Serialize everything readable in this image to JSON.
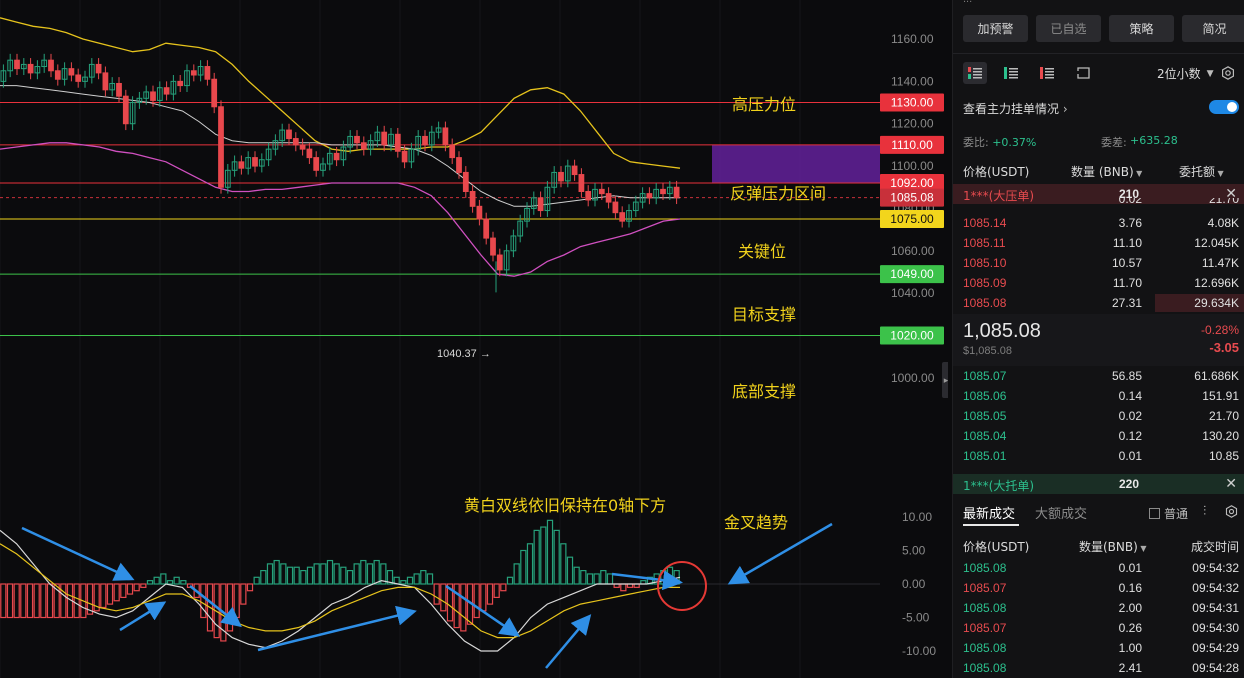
{
  "chart": {
    "price_axis": [
      "1160.00",
      "1140.00",
      "1120.00",
      "1100.00",
      "1080.00",
      "1060.00",
      "1040.00",
      "1020.00",
      "1000.00"
    ],
    "macd_axis": [
      "10.00",
      "5.00",
      "0.00",
      "-5.00",
      "-10.00"
    ],
    "price_tags": [
      {
        "label": "1130.00",
        "price": 1130,
        "color": "#e8323c",
        "text_color": "#ffffff"
      },
      {
        "label": "1110.00",
        "price": 1110,
        "color": "#e8323c",
        "text_color": "#ffffff"
      },
      {
        "label": "1092.00",
        "price": 1092,
        "color": "#e8323c",
        "text_color": "#ffffff"
      },
      {
        "label": "1085.08",
        "price": 1085.08,
        "color": "#c8303a",
        "text_color": "#ffffff"
      },
      {
        "label": "1075.00",
        "price": 1075,
        "color": "#f2d51c",
        "text_color": "#111111"
      },
      {
        "label": "1049.00",
        "price": 1049,
        "color": "#3cc24a",
        "text_color": "#ffffff"
      },
      {
        "label": "1020.00",
        "price": 1020,
        "color": "#3cc24a",
        "text_color": "#ffffff"
      }
    ],
    "annotations": {
      "high_resistance": "高压力位",
      "rebound_zone": "反弹压力区间",
      "key_level": "关键位",
      "target_support": "目标支撑",
      "bottom_support": "底部支撑",
      "macd_note": "黄白双线依旧保持在0轴下方",
      "golden_cross": "金叉趋势"
    },
    "low_marker": "1040.37 →",
    "colors": {
      "up": "#26a17b",
      "down": "#e8484d",
      "boll_upper": "#e6c31c",
      "boll_mid": "#cfcfcf",
      "boll_lower": "#d050c0",
      "zone": "#5a1f8c",
      "arrow": "#2f8fe6"
    }
  },
  "chart_data": {
    "type": "line",
    "title": "",
    "ylim": [
      995,
      1168
    ],
    "candles": [
      {
        "o": 1140,
        "c": 1145
      },
      {
        "o": 1145,
        "c": 1150
      },
      {
        "o": 1150,
        "c": 1146
      },
      {
        "o": 1146,
        "c": 1148
      },
      {
        "o": 1148,
        "c": 1144
      },
      {
        "o": 1144,
        "c": 1147
      },
      {
        "o": 1147,
        "c": 1150
      },
      {
        "o": 1150,
        "c": 1145
      },
      {
        "o": 1145,
        "c": 1141
      },
      {
        "o": 1141,
        "c": 1146
      },
      {
        "o": 1146,
        "c": 1143
      },
      {
        "o": 1143,
        "c": 1140
      },
      {
        "o": 1140,
        "c": 1142
      },
      {
        "o": 1142,
        "c": 1148
      },
      {
        "o": 1148,
        "c": 1144
      },
      {
        "o": 1144,
        "c": 1136
      },
      {
        "o": 1136,
        "c": 1139
      },
      {
        "o": 1139,
        "c": 1133
      },
      {
        "o": 1133,
        "c": 1120
      },
      {
        "o": 1120,
        "c": 1130
      },
      {
        "o": 1130,
        "c": 1132
      },
      {
        "o": 1132,
        "c": 1135
      },
      {
        "o": 1135,
        "c": 1131
      },
      {
        "o": 1131,
        "c": 1137
      },
      {
        "o": 1137,
        "c": 1134
      },
      {
        "o": 1134,
        "c": 1140
      },
      {
        "o": 1140,
        "c": 1138
      },
      {
        "o": 1138,
        "c": 1145
      },
      {
        "o": 1145,
        "c": 1143
      },
      {
        "o": 1143,
        "c": 1147
      },
      {
        "o": 1147,
        "c": 1141
      },
      {
        "o": 1141,
        "c": 1128
      },
      {
        "o": 1128,
        "c": 1090
      },
      {
        "o": 1090,
        "c": 1098
      },
      {
        "o": 1098,
        "c": 1102
      },
      {
        "o": 1102,
        "c": 1099
      },
      {
        "o": 1099,
        "c": 1104
      },
      {
        "o": 1104,
        "c": 1100
      },
      {
        "o": 1100,
        "c": 1103
      },
      {
        "o": 1103,
        "c": 1108
      },
      {
        "o": 1108,
        "c": 1112
      },
      {
        "o": 1112,
        "c": 1117
      },
      {
        "o": 1117,
        "c": 1113
      },
      {
        "o": 1113,
        "c": 1110
      },
      {
        "o": 1110,
        "c": 1108
      },
      {
        "o": 1108,
        "c": 1104
      },
      {
        "o": 1104,
        "c": 1098
      },
      {
        "o": 1098,
        "c": 1101
      },
      {
        "o": 1101,
        "c": 1106
      },
      {
        "o": 1106,
        "c": 1103
      },
      {
        "o": 1103,
        "c": 1109
      },
      {
        "o": 1109,
        "c": 1114
      },
      {
        "o": 1114,
        "c": 1111
      },
      {
        "o": 1111,
        "c": 1108
      },
      {
        "o": 1108,
        "c": 1112
      },
      {
        "o": 1112,
        "c": 1116
      },
      {
        "o": 1116,
        "c": 1110
      },
      {
        "o": 1110,
        "c": 1115
      },
      {
        "o": 1115,
        "c": 1107
      },
      {
        "o": 1107,
        "c": 1102
      },
      {
        "o": 1102,
        "c": 1108
      },
      {
        "o": 1108,
        "c": 1114
      },
      {
        "o": 1114,
        "c": 1110
      },
      {
        "o": 1110,
        "c": 1116
      },
      {
        "o": 1116,
        "c": 1118
      },
      {
        "o": 1118,
        "c": 1110
      },
      {
        "o": 1110,
        "c": 1104
      },
      {
        "o": 1104,
        "c": 1097
      },
      {
        "o": 1097,
        "c": 1088
      },
      {
        "o": 1088,
        "c": 1081
      },
      {
        "o": 1081,
        "c": 1075
      },
      {
        "o": 1075,
        "c": 1066
      },
      {
        "o": 1066,
        "c": 1058
      },
      {
        "o": 1058,
        "c": 1051
      },
      {
        "o": 1051,
        "c": 1060
      },
      {
        "o": 1060,
        "c": 1067
      },
      {
        "o": 1067,
        "c": 1074
      },
      {
        "o": 1074,
        "c": 1080
      },
      {
        "o": 1080,
        "c": 1085
      },
      {
        "o": 1085,
        "c": 1079
      },
      {
        "o": 1079,
        "c": 1090
      },
      {
        "o": 1090,
        "c": 1097
      },
      {
        "o": 1097,
        "c": 1093
      },
      {
        "o": 1093,
        "c": 1100
      },
      {
        "o": 1100,
        "c": 1096
      },
      {
        "o": 1096,
        "c": 1088
      },
      {
        "o": 1088,
        "c": 1084
      },
      {
        "o": 1084,
        "c": 1089
      },
      {
        "o": 1089,
        "c": 1087
      },
      {
        "o": 1087,
        "c": 1083
      },
      {
        "o": 1083,
        "c": 1078
      },
      {
        "o": 1078,
        "c": 1074
      },
      {
        "o": 1074,
        "c": 1079
      },
      {
        "o": 1079,
        "c": 1083
      },
      {
        "o": 1083,
        "c": 1087
      },
      {
        "o": 1087,
        "c": 1085
      },
      {
        "o": 1085,
        "c": 1089
      },
      {
        "o": 1089,
        "c": 1087
      },
      {
        "o": 1087,
        "c": 1090
      },
      {
        "o": 1090,
        "c": 1085.08
      }
    ],
    "boll_upper": [
      1170,
      1168,
      1166,
      1165,
      1163,
      1160,
      1158,
      1156,
      1154,
      1155,
      1158,
      1157,
      1156,
      1154,
      1148,
      1140,
      1133,
      1126,
      1119,
      1112,
      1108,
      1107,
      1108,
      1108,
      1108,
      1108,
      1109,
      1109,
      1112,
      1116,
      1124,
      1132,
      1136,
      1137,
      1134,
      1126,
      1116,
      1106,
      1102,
      1101,
      1100,
      1099
    ],
    "boll_mid": [
      1138,
      1138,
      1137,
      1136,
      1135,
      1134,
      1133,
      1132,
      1131,
      1130,
      1128,
      1126,
      1121,
      1115,
      1112,
      1111,
      1111,
      1111,
      1111,
      1111,
      1110,
      1110,
      1110,
      1110,
      1109,
      1108,
      1105,
      1100,
      1094,
      1088,
      1084,
      1081,
      1081,
      1082,
      1083,
      1084,
      1085,
      1086,
      1085,
      1085,
      1085,
      1085
    ],
    "boll_lower": [
      1108,
      1109,
      1110,
      1111,
      1111,
      1110,
      1109,
      1107,
      1106,
      1104,
      1102,
      1098,
      1094,
      1090,
      1088,
      1088,
      1089,
      1089,
      1090,
      1091,
      1092,
      1092,
      1092,
      1092,
      1092,
      1090,
      1086,
      1078,
      1068,
      1058,
      1049,
      1048,
      1050,
      1055,
      1058,
      1062,
      1064,
      1066,
      1068,
      1071,
      1074,
      1075
    ],
    "macd_hist": [
      -5,
      -5,
      -5,
      -5,
      -5,
      -5,
      -5,
      -5,
      -5,
      -5,
      -5,
      -5,
      -5,
      -4.5,
      -4,
      -3.5,
      -3,
      -2.5,
      -2,
      -1.5,
      -1,
      -0.5,
      0.5,
      1,
      1.5,
      0.5,
      1,
      0.5,
      -0.5,
      -2,
      -5,
      -7,
      -8,
      -8.5,
      -7,
      -5,
      -3,
      -1,
      1,
      2,
      3,
      3.5,
      3,
      2.5,
      2.5,
      2,
      2.5,
      3,
      3,
      3.5,
      3,
      2.5,
      2,
      3,
      3.5,
      3,
      3.5,
      3,
      2,
      1,
      0.5,
      1,
      1.5,
      2,
      1.5,
      -3,
      -4,
      -5.5,
      -6.5,
      -7,
      -6,
      -5,
      -4,
      -3,
      -2,
      -1,
      1,
      3,
      5,
      6,
      8,
      8.5,
      9.5,
      8,
      6,
      4,
      2.5,
      2,
      1.5,
      1.5,
      2,
      1.5,
      -0.5,
      -1,
      -0.5,
      -0.5,
      0.5,
      1,
      1.5,
      2,
      2.5,
      2
    ],
    "dif": [
      8,
      6,
      3,
      0,
      -2,
      -3.5,
      -4.5,
      -5,
      -4,
      -2,
      0,
      -0.5,
      -3,
      -6,
      -8,
      -9,
      -9.5,
      -8.5,
      -7,
      -5,
      -3,
      -2,
      -0.5,
      0.5,
      0,
      -0.5,
      -3,
      -6,
      -8.5,
      -10,
      -10,
      -8,
      -5,
      -3,
      -2,
      -1,
      0,
      0,
      0,
      0,
      0.5,
      1
    ],
    "dea": [
      6,
      4.5,
      2.5,
      0.5,
      -1.5,
      -2.5,
      -3.5,
      -4,
      -3.5,
      -2.5,
      -1.5,
      -1.5,
      -2.5,
      -4,
      -5.5,
      -6.5,
      -7,
      -7,
      -6.5,
      -5.5,
      -4,
      -3,
      -2,
      -1,
      -0.5,
      -0.5,
      -1.5,
      -3,
      -5,
      -7,
      -8,
      -8,
      -7,
      -5.5,
      -4,
      -3,
      -2.5,
      -2,
      -1.5,
      -1,
      -0.5,
      -0.5
    ],
    "levels": [
      1130,
      1110,
      1092,
      1075,
      1049,
      1020
    ],
    "zone": [
      1092,
      1110
    ],
    "low_value": 1040.37
  },
  "panel": {
    "top_cut_text": "...",
    "buttons": [
      "加预警",
      "已自选",
      "策略",
      "简况"
    ],
    "decimals": "2位小数",
    "toggle_label": "查看主力挂单情况",
    "ratio_label": "委比:",
    "ratio_value": "+0.37%",
    "diff_label": "委差:",
    "diff_value": "+635.28",
    "head_price": "价格(USDT)",
    "head_qty": "数量 (BNB)",
    "head_total": "委托额",
    "big_ask_label": "1***(大压单)",
    "big_ask_qty": "210",
    "big_bid_label": "1***(大托单)",
    "big_bid_qty": "220",
    "asks_partial": {
      "price": "",
      "qty": "0.02",
      "total": "21.70"
    },
    "asks": [
      {
        "price": "1085.14",
        "qty": "3.76",
        "total": "4.08K"
      },
      {
        "price": "1085.11",
        "qty": "11.10",
        "total": "12.045K"
      },
      {
        "price": "1085.10",
        "qty": "10.57",
        "total": "11.47K"
      },
      {
        "price": "1085.09",
        "qty": "11.70",
        "total": "12.696K"
      },
      {
        "price": "1085.08",
        "qty": "27.31",
        "total": "29.634K"
      }
    ],
    "last_price": "1,085.08",
    "last_price_usd": "$1,085.08",
    "change_pct": "-0.28%",
    "change_abs": "-3.05",
    "bids": [
      {
        "price": "1085.07",
        "qty": "56.85",
        "total": "61.686K"
      },
      {
        "price": "1085.06",
        "qty": "0.14",
        "total": "151.91"
      },
      {
        "price": "1085.05",
        "qty": "0.02",
        "total": "21.70"
      },
      {
        "price": "1085.04",
        "qty": "0.12",
        "total": "130.20"
      },
      {
        "price": "1085.01",
        "qty": "0.01",
        "total": "10.85"
      }
    ],
    "tab_latest": "最新成交",
    "tab_large": "大额成交",
    "normal_label": "普通",
    "trade_head_price": "价格(USDT)",
    "trade_head_qty": "数量(BNB)",
    "trade_head_time": "成交时间",
    "trades": [
      {
        "price": "1085.08",
        "qty": "0.01",
        "time": "09:54:32",
        "side": "buy"
      },
      {
        "price": "1085.07",
        "qty": "0.16",
        "time": "09:54:32",
        "side": "sell"
      },
      {
        "price": "1085.08",
        "qty": "2.00",
        "time": "09:54:31",
        "side": "buy"
      },
      {
        "price": "1085.07",
        "qty": "0.26",
        "time": "09:54:30",
        "side": "sell"
      },
      {
        "price": "1085.08",
        "qty": "1.00",
        "time": "09:54:29",
        "side": "buy"
      },
      {
        "price": "1085.08",
        "qty": "2.41",
        "time": "09:54:28",
        "side": "buy"
      }
    ]
  }
}
